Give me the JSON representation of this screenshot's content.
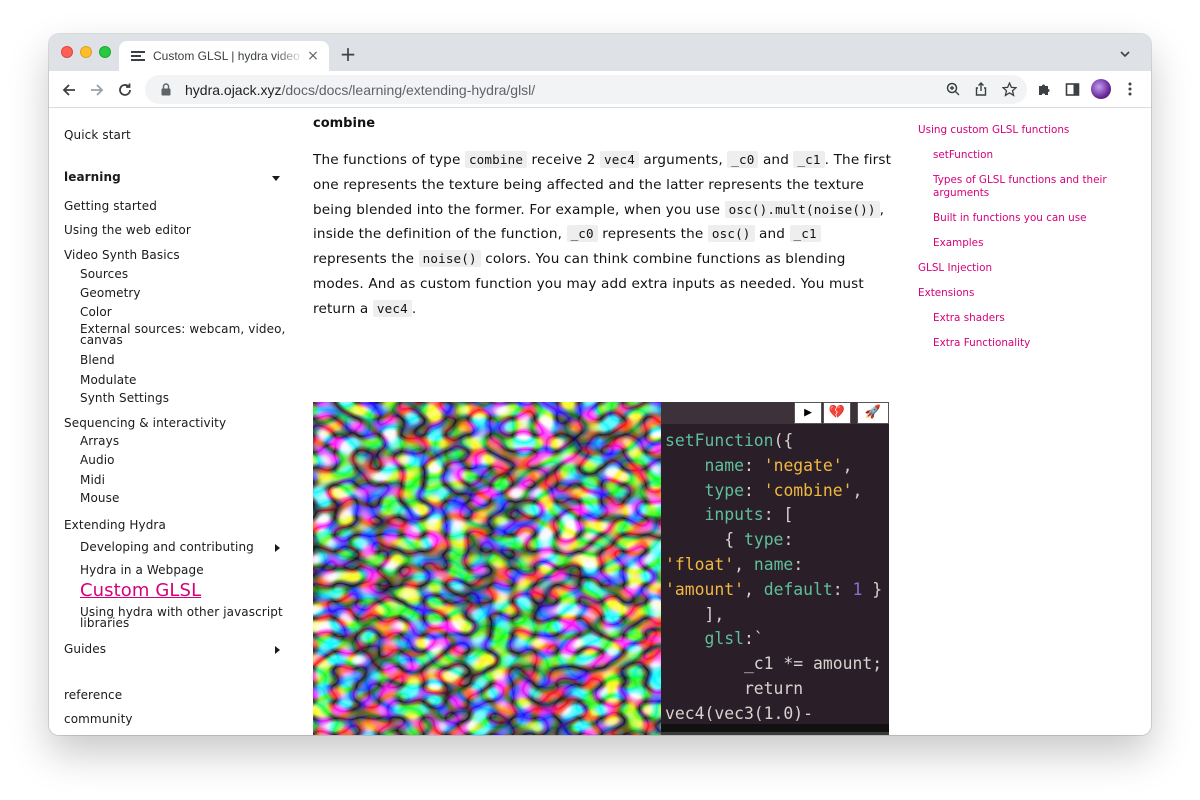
{
  "browser": {
    "tab_title": "Custom GLSL | hydra video synth",
    "tab_close": "×",
    "new_tab": "+",
    "url_host": "hydra.ojack.xyz",
    "url_path": "/docs/docs/learning/extending-hydra/glsl/"
  },
  "left_nav": {
    "quick_start": "Quick start",
    "learning": "learning",
    "getting_started": "Getting started",
    "web_editor": "Using the web editor",
    "video_synth_basics": "Video Synth Basics",
    "basics_items": [
      "Sources",
      "Geometry",
      "Color",
      "External sources: webcam, video,",
      "canvas",
      "Blend",
      "Modulate",
      "Synth Settings"
    ],
    "sequencing": "Sequencing & interactivity",
    "sequencing_items": [
      "Arrays",
      "Audio",
      "Midi",
      "Mouse"
    ],
    "extending": "Extending Hydra",
    "extending_items": [
      "Developing and contributing",
      "Hydra in a Webpage"
    ],
    "active_item": "Custom GLSL",
    "other_libs": [
      "Using hydra with other javascript",
      "libraries"
    ],
    "guides": "Guides",
    "reference": "reference",
    "community": "community"
  },
  "main": {
    "heading": "combine",
    "para": {
      "t1": "The functions of type ",
      "c1": "combine",
      "t2": " receive 2 ",
      "c2": "vec4",
      "t3": " arguments, ",
      "c3": "_c0",
      "t4": " and ",
      "c4": "_c1",
      "t5": ". The first one represents the texture being affected and the latter represents the texture being blended into the former. For example, when you use ",
      "c5": "osc().mult(noise())",
      "t6": ", inside the definition of the function, ",
      "c6": "_c0",
      "t7": " represents the ",
      "c7": "osc()",
      "t8": " and ",
      "c8": "_c1",
      "t9": " represents the ",
      "c9": "noise()",
      "t10": " colors. You can think combine functions as blending modes. And as custom function you may add extra inputs as needed. You must return a ",
      "c10": "vec4",
      "t11": "."
    }
  },
  "editor": {
    "run_button": "▶",
    "clear_button": "💔",
    "share_button": "🚀",
    "code": {
      "l1a": "setFunction",
      "l1b": "({",
      "l2a": "    name",
      "l2b": ": ",
      "l2c": "'negate'",
      "l2d": ",",
      "l3a": "    type",
      "l3b": ": ",
      "l3c": "'combine'",
      "l3d": ",",
      "l4a": "    inputs",
      "l4b": ": [",
      "l5a": "      { ",
      "l5b": "type",
      "l5c": ":",
      "l6a": "'float'",
      "l6b": ", ",
      "l6c": "name",
      "l6d": ":",
      "l7a": "'amount'",
      "l7b": ", ",
      "l7c": "default",
      "l7d": ": ",
      "l7e": "1",
      "l7f": " }",
      "l8": "    ],",
      "l9a": "    glsl",
      "l9b": ":`",
      "l10": "        _c1 *= amount;",
      "l11": "        return",
      "l12": "vec4(vec3(1.0)-"
    },
    "console_prompt": ">>"
  },
  "toc": {
    "items": [
      "Using custom GLSL functions",
      "setFunction",
      "Types of GLSL functions and their",
      "arguments",
      "Built in functions you can use",
      "Examples",
      "GLSL Injection",
      "Extensions",
      "Extra shaders",
      "Extra Functionality"
    ]
  },
  "colors": {
    "accent": "#d6007a",
    "editor_bg": "#2a1f28",
    "code_keyword": "#5fbf9a",
    "code_string": "#f0b840",
    "code_number": "#8d6fd4"
  }
}
